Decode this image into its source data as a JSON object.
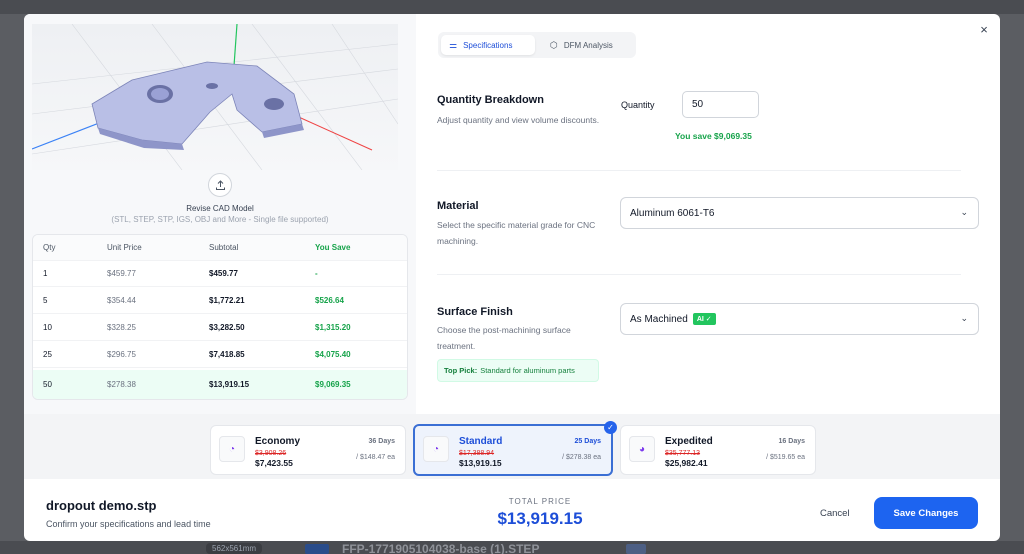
{
  "background": {
    "badge": "562x561mm",
    "file": "FFP-1771905104038-base (1).STEP"
  },
  "modal": {
    "close_glyph": "×",
    "left": {
      "revise_title": "Revise CAD Model",
      "revise_sub": "(STL, STEP, STP, IGS, OBJ and More - Single file supported)",
      "table": {
        "headers": [
          "Qty",
          "Unit Price",
          "Subtotal",
          "You Save"
        ],
        "rows": [
          [
            "1",
            "$459.77",
            "$459.77",
            "-"
          ],
          [
            "5",
            "$354.44",
            "$1,772.21",
            "$526.64"
          ],
          [
            "10",
            "$328.25",
            "$3,282.50",
            "$1,315.20"
          ],
          [
            "25",
            "$296.75",
            "$7,418.85",
            "$4,075.40"
          ],
          [
            "50",
            "$278.38",
            "$13,919.15",
            "$9,069.35"
          ]
        ]
      }
    },
    "tabs": [
      {
        "label": "Specifications",
        "icon": "sliders-icon"
      },
      {
        "label": "DFM Analysis",
        "icon": "cube-icon"
      }
    ],
    "quantity": {
      "title": "Quantity Breakdown",
      "desc": "Adjust quantity and view volume discounts.",
      "label": "Quantity",
      "value": "50",
      "save_text": "You save $9,069.35"
    },
    "material": {
      "title": "Material",
      "desc": "Select the specific material grade for CNC machining.",
      "value": "Aluminum 6061-T6"
    },
    "finish": {
      "title": "Surface Finish",
      "desc": "Choose the post-machining surface treatment.",
      "value": "As Machined",
      "ai_badge": "AI ✓",
      "top_pick_label": "Top Pick:",
      "top_pick_text": "Standard for aluminum parts"
    },
    "lead_times": [
      {
        "name": "Economy",
        "days": "36 Days",
        "old": "$3,908.26",
        "new": "$7,423.55",
        "ea": "/ $148.47 ea"
      },
      {
        "name": "Standard",
        "days": "25 Days",
        "old": "$17,388.94",
        "new": "$13,919.15",
        "ea": "/ $278.38 ea"
      },
      {
        "name": "Expedited",
        "days": "16 Days",
        "old": "$35,777.13",
        "new": "$25,982.41",
        "ea": "/ $519.65 ea"
      }
    ],
    "footer": {
      "file_name": "dropout demo.stp",
      "file_sub": "Confirm your specifications and lead time",
      "total_label": "TOTAL PRICE",
      "total_value": "$13,919.15",
      "cancel": "Cancel",
      "save": "Save Changes"
    }
  }
}
